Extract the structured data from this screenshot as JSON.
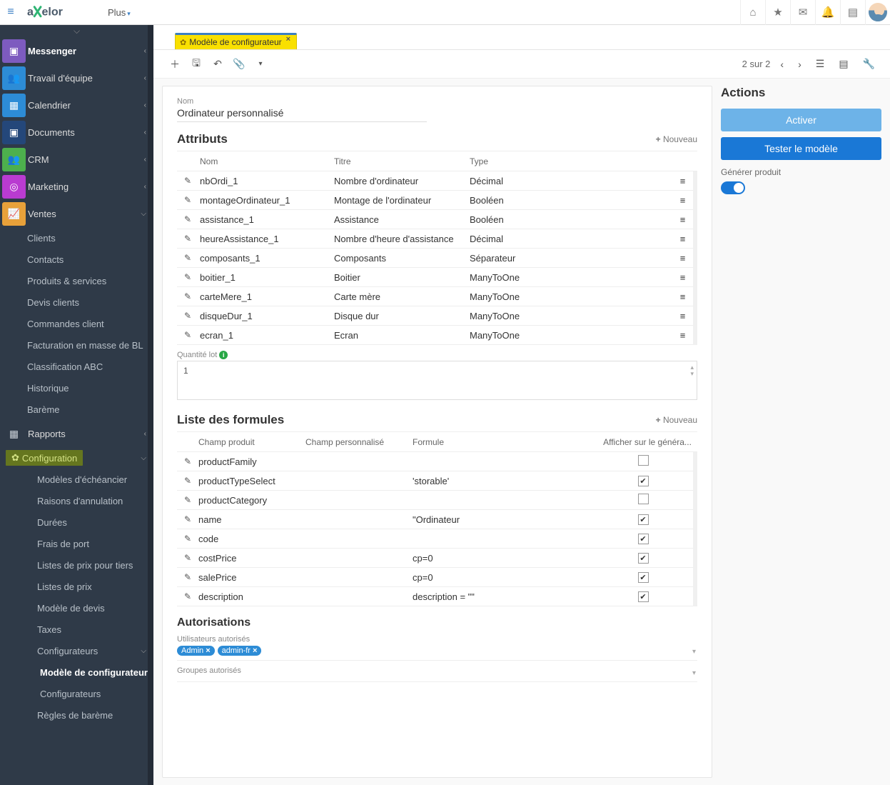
{
  "topbar": {
    "plus_label": "Plus",
    "icons": [
      "home-icon",
      "star-icon",
      "envelope-icon",
      "bell-icon",
      "book-icon",
      "avatar-icon"
    ]
  },
  "sidebar": {
    "items": [
      {
        "icon": "picture",
        "color": "#7d5bbf",
        "label": "Messenger",
        "bold": true,
        "chev": true
      },
      {
        "icon": "users",
        "color": "#2d8cd6",
        "label": "Travail d'équipe",
        "chev": true
      },
      {
        "icon": "calendar",
        "color": "#2d8cd6",
        "label": "Calendrier",
        "chev": true
      },
      {
        "icon": "file",
        "color": "#24477a",
        "label": "Documents",
        "chev": true
      },
      {
        "icon": "users",
        "color": "#4db04d",
        "label": "CRM",
        "chev": true
      },
      {
        "icon": "bullseye",
        "color": "#b93bd1",
        "label": "Marketing",
        "chev": true
      },
      {
        "icon": "chart",
        "color": "#e8a13a",
        "label": "Ventes",
        "chev": true,
        "open": true
      }
    ],
    "ventes_sub": [
      "Clients",
      "Contacts",
      "Produits & services",
      "Devis clients",
      "Commandes client",
      "Facturation en masse de BL",
      "Classification ABC",
      "Historique",
      "Barème"
    ],
    "rapports_label": "Rapports",
    "config_label": "Configuration",
    "config_sub": [
      "Modèles d'échéancier",
      "Raisons d'annulation",
      "Durées",
      "Frais de port",
      "Listes de prix pour tiers",
      "Listes de prix",
      "Modèle de devis",
      "Taxes"
    ],
    "configurateurs_label": "Configurateurs",
    "configurateurs_sub": [
      "Modèle de configurateur",
      "Configurateurs"
    ],
    "regles_label": "Règles de barème"
  },
  "tab": {
    "label": "Modèle de configurateur"
  },
  "toolbar": {
    "pager": "2 sur 2"
  },
  "form": {
    "name_label": "Nom",
    "name_value": "Ordinateur personnalisé",
    "attributes_title": "Attributs",
    "new_label": "Nouveau",
    "attr_head": {
      "name": "Nom",
      "title": "Titre",
      "type": "Type"
    },
    "attributes": [
      {
        "name": "nbOrdi_1",
        "title": "Nombre d'ordinateur",
        "type": "Décimal"
      },
      {
        "name": "montageOrdinateur_1",
        "title": "Montage de l'ordinateur",
        "type": "Booléen"
      },
      {
        "name": "assistance_1",
        "title": "Assistance",
        "type": "Booléen"
      },
      {
        "name": "heureAssistance_1",
        "title": "Nombre d'heure d'assistance",
        "type": "Décimal"
      },
      {
        "name": "composants_1",
        "title": "Composants",
        "type": "Séparateur"
      },
      {
        "name": "boitier_1",
        "title": "Boitier",
        "type": "ManyToOne"
      },
      {
        "name": "carteMere_1",
        "title": "Carte mère",
        "type": "ManyToOne"
      },
      {
        "name": "disqueDur_1",
        "title": "Disque dur",
        "type": "ManyToOne"
      },
      {
        "name": "ecran_1",
        "title": "Ecran",
        "type": "ManyToOne"
      }
    ],
    "qty_label": "Quantité lot",
    "qty_value": "1",
    "formulas_title": "Liste des formules",
    "formula_head": {
      "field": "Champ produit",
      "custom": "Champ personnalisé",
      "formula": "Formule",
      "show": "Afficher sur le généra..."
    },
    "formulas": [
      {
        "field": "productFamily",
        "formula": "",
        "show": false
      },
      {
        "field": "productTypeSelect",
        "formula": "'storable'",
        "show": true
      },
      {
        "field": "productCategory",
        "formula": "",
        "show": false
      },
      {
        "field": "name",
        "formula": "\"Ordinateur",
        "show": true
      },
      {
        "field": "code",
        "formula": "",
        "show": true
      },
      {
        "field": "costPrice",
        "formula": "cp=0",
        "show": true
      },
      {
        "field": "salePrice",
        "formula": "cp=0",
        "show": true
      },
      {
        "field": "description",
        "formula": "description = \"\"",
        "show": true
      }
    ],
    "auth_title": "Autorisations",
    "auth_users_label": "Utilisateurs autorisés",
    "auth_users": [
      "Admin",
      "admin-fr"
    ],
    "auth_groups_label": "Groupes autorisés"
  },
  "actions": {
    "title": "Actions",
    "activate": "Activer",
    "test": "Tester le modèle",
    "generate_label": "Générer produit"
  }
}
